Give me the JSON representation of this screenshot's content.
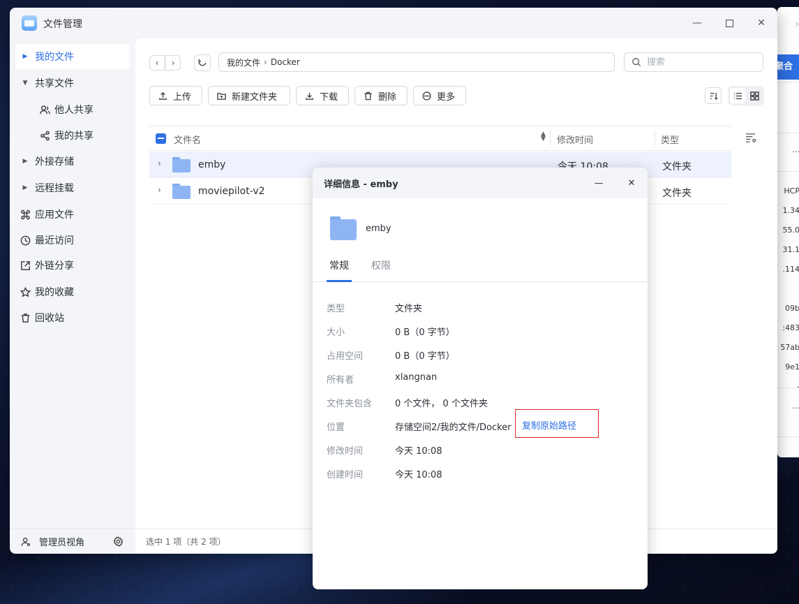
{
  "app": {
    "title": "文件管理"
  },
  "sidebar": {
    "items": [
      {
        "label": "我的文件"
      },
      {
        "label": "共享文件"
      },
      {
        "label": "他人共享"
      },
      {
        "label": "我的共享"
      },
      {
        "label": "外接存储"
      },
      {
        "label": "远程挂载"
      },
      {
        "label": "应用文件"
      },
      {
        "label": "最近访问"
      },
      {
        "label": "外链分享"
      },
      {
        "label": "我的收藏"
      },
      {
        "label": "回收站"
      }
    ],
    "footer_label": "管理员视角"
  },
  "pathbar": {
    "root": "我的文件",
    "current": "Docker"
  },
  "search": {
    "placeholder": "搜索"
  },
  "toolbar": {
    "upload": "上传",
    "new_folder": "新建文件夹",
    "download": "下载",
    "delete": "删除",
    "more": "更多"
  },
  "table": {
    "headers": {
      "name": "文件名",
      "modified": "修改时间",
      "type": "类型"
    },
    "rows": [
      {
        "name": "emby",
        "modified": "今天 10:08",
        "type": "文件夹"
      },
      {
        "name": "moviepilot-v2",
        "modified": "",
        "type": "文件夹"
      }
    ]
  },
  "status": {
    "text": "选中 1 项（共 2 项）"
  },
  "dialog": {
    "title": "详细信息 - emby",
    "name": "emby",
    "tabs": {
      "general": "常规",
      "permissions": "权限"
    },
    "props": {
      "type_k": "类型",
      "type_v": "文件夹",
      "size_k": "大小",
      "size_v": "0 B（0 字节）",
      "used_k": "占用空间",
      "used_v": "0 B（0 字节）",
      "owner_k": "所有者",
      "owner_v": "xlangnan",
      "contains_k": "文件夹包含",
      "contains_v": "0 个文件， 0 个文件夹",
      "location_k": "位置",
      "location_v": "存储空间2/我的文件/Docker",
      "modified_k": "修改时间",
      "modified_v": "今天 10:08",
      "created_k": "创建时间",
      "created_v": "今天 10:08"
    },
    "copy_path": "复制原始路径"
  },
  "background_window": {
    "button": "聚合",
    "values": [
      "HCP",
      "1.34",
      "55.0",
      "31.1",
      ".114",
      "",
      "09b",
      ":483",
      "57ab",
      "9e1",
      "-"
    ]
  },
  "colors": {
    "accent": "#2f6fe4",
    "highlight_border": "#e02424"
  }
}
